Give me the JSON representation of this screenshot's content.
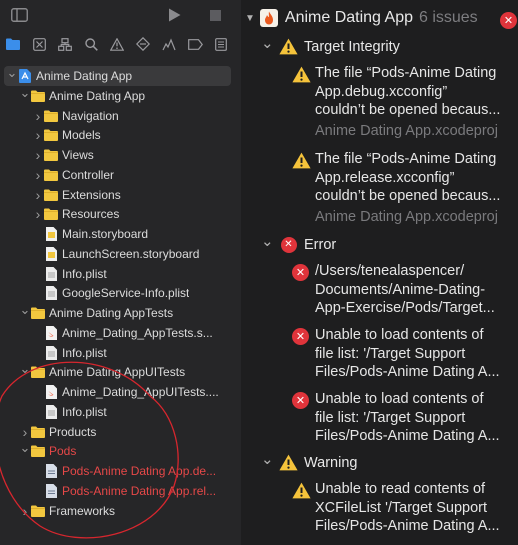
{
  "navigator": {
    "toolbar_icons": [
      "sidebar-toggle-icon",
      "run-icon",
      "stop-icon"
    ],
    "tabs": [
      "project-navigator-icon",
      "source-control-icon",
      "symbol-navigator-icon",
      "find-icon",
      "issue-navigator-icon",
      "test-navigator-icon",
      "debug-navigator-icon",
      "breakpoint-icon",
      "report-icon"
    ],
    "tree": [
      {
        "label": "Anime Dating App",
        "kind": "project",
        "expanded": true,
        "depth": 0,
        "selected": true,
        "red": false
      },
      {
        "label": "Anime Dating App",
        "kind": "folder",
        "expanded": true,
        "depth": 1,
        "red": false
      },
      {
        "label": "Navigation",
        "kind": "folder",
        "expanded": false,
        "depth": 2,
        "red": false
      },
      {
        "label": "Models",
        "kind": "folder",
        "expanded": false,
        "depth": 2,
        "red": false
      },
      {
        "label": "Views",
        "kind": "folder",
        "expanded": false,
        "depth": 2,
        "red": false
      },
      {
        "label": "Controller",
        "kind": "folder",
        "expanded": false,
        "depth": 2,
        "red": false
      },
      {
        "label": "Extensions",
        "kind": "folder",
        "expanded": false,
        "depth": 2,
        "red": false
      },
      {
        "label": "Resources",
        "kind": "folder",
        "expanded": false,
        "depth": 2,
        "red": false
      },
      {
        "label": "Main.storyboard",
        "kind": "storyboard",
        "depth": 2,
        "red": false
      },
      {
        "label": "LaunchScreen.storyboard",
        "kind": "storyboard",
        "depth": 2,
        "red": false
      },
      {
        "label": "Info.plist",
        "kind": "plist",
        "depth": 2,
        "red": false
      },
      {
        "label": "GoogleService-Info.plist",
        "kind": "plist",
        "depth": 2,
        "red": false
      },
      {
        "label": "Anime Dating AppTests",
        "kind": "folder",
        "expanded": true,
        "depth": 1,
        "red": false
      },
      {
        "label": "Anime_Dating_AppTests.s...",
        "kind": "swift",
        "depth": 2,
        "red": false
      },
      {
        "label": "Info.plist",
        "kind": "plist",
        "depth": 2,
        "red": false
      },
      {
        "label": "Anime Dating AppUITests",
        "kind": "folder",
        "expanded": true,
        "depth": 1,
        "red": false
      },
      {
        "label": "Anime_Dating_AppUITests....",
        "kind": "swift",
        "depth": 2,
        "red": false
      },
      {
        "label": "Info.plist",
        "kind": "plist",
        "depth": 2,
        "red": false
      },
      {
        "label": "Products",
        "kind": "folder",
        "expanded": false,
        "depth": 1,
        "red": false
      },
      {
        "label": "Pods",
        "kind": "folder",
        "expanded": true,
        "depth": 1,
        "red": true
      },
      {
        "label": "Pods-Anime Dating App.de...",
        "kind": "xcconfig",
        "depth": 2,
        "red": true
      },
      {
        "label": "Pods-Anime Dating App.rel...",
        "kind": "xcconfig",
        "depth": 2,
        "red": true
      },
      {
        "label": "Frameworks",
        "kind": "folder",
        "expanded": false,
        "depth": 1,
        "red": false
      }
    ]
  },
  "issues": {
    "title": "Anime Dating App",
    "count": "6 issues",
    "groups": {
      "target": {
        "label": "Target Integrity",
        "items": [
          {
            "lines": [
              "The file “Pods-Anime Dating",
              "App.debug.xcconfig”",
              "couldn’t be opened becaus..."
            ],
            "source": "Anime Dating App.xcodeproj"
          },
          {
            "lines": [
              "The file “Pods-Anime Dating",
              "App.release.xcconfig”",
              "couldn’t be opened becaus..."
            ],
            "source": "Anime Dating App.xcodeproj"
          }
        ]
      },
      "error": {
        "label": "Error",
        "items": [
          {
            "lines": [
              "/Users/tenealaspencer/",
              "Documents/Anime-Dating-",
              "App-Exercise/Pods/Target..."
            ]
          },
          {
            "lines": [
              "Unable to load contents of",
              "file list: '/Target Support",
              "Files/Pods-Anime Dating A..."
            ]
          },
          {
            "lines": [
              "Unable to load contents of",
              "file list: '/Target Support",
              "Files/Pods-Anime Dating A..."
            ]
          }
        ]
      },
      "warning": {
        "label": "Warning",
        "items": [
          {
            "lines": [
              "Unable to read contents of",
              "XCFileList '/Target Support",
              "Files/Pods-Anime Dating A..."
            ]
          }
        ]
      }
    }
  },
  "colors": {
    "accent_blue": "#3b8eea",
    "folder_yellow": "#f2c73f",
    "warning_yellow": "#f5c33b",
    "error_red": "#e0343b",
    "annotation_red": "#d7262e"
  }
}
